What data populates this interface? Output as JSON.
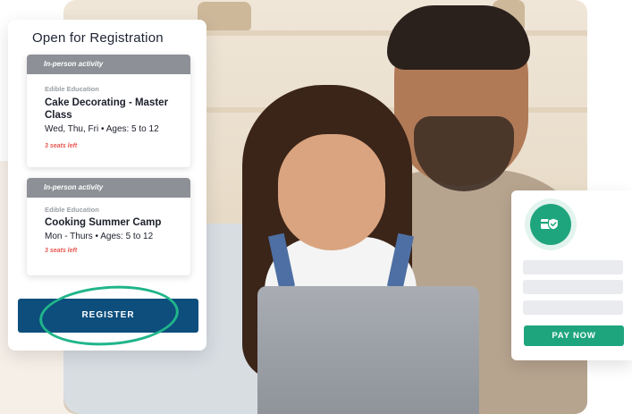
{
  "registration": {
    "title": "Open for Registration",
    "activities": [
      {
        "type_label": "In-person activity",
        "provider": "Edible Education",
        "name": "Cake Decorating - Master Class",
        "schedule": "Wed, Thu, Fri • Ages: 5 to 12",
        "seats": "3 seats left"
      },
      {
        "type_label": "In-person activity",
        "provider": "Edible Education",
        "name": "Cooking Summer Camp",
        "schedule": "Mon - Thurs • Ages: 5 to 12",
        "seats": "3 seats left"
      }
    ],
    "register_label": "REGISTER"
  },
  "payment": {
    "icon": "secure-card-icon",
    "pay_label": "PAY NOW"
  },
  "colors": {
    "register": "#0d4e7c",
    "accent_green": "#1fa57e",
    "seats_red": "#e8574f",
    "header_gray": "#8d9096"
  }
}
